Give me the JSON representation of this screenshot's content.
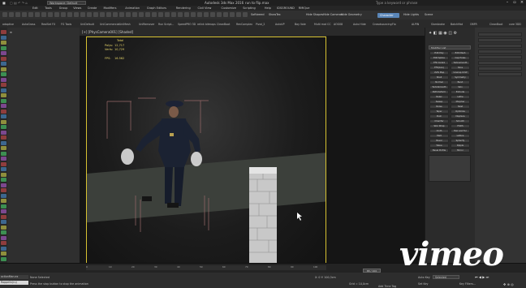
{
  "title_bar": {
    "workspace": "Workspace: Default",
    "app_title": "Autodesk 3ds Max 2016",
    "file_name": "run to flip.max",
    "search_placeholder": "Type a keyword or phrase"
  },
  "menu": [
    "Edit",
    "Tools",
    "Group",
    "Views",
    "Create",
    "Modifiers",
    "Animation",
    "Graph Editors",
    "Rendering",
    "Civil View",
    "Customize",
    "Scripting",
    "Help",
    "IDSGROUND",
    "RMIQue"
  ],
  "toolbar": {
    "labels": [
      "Softbreed",
      "ShowTex",
      "Hide Shapes",
      "Hide Cameras",
      "Hide Geometry",
      "Hide Lights",
      "Scene"
    ],
    "highlighted": "Character"
  },
  "shelf": [
    "adaptive",
    "AutoGrass",
    "RealSet FX",
    "FG Tools",
    "UniDefault",
    "UniCommercial",
    "UniMesh",
    "UniRemover",
    "Run Script...",
    "SpeedPRO 3D",
    "relink bitmaps",
    "CleanBoot",
    "RenComplex",
    "Pivot_2",
    "AutoVP",
    "Bay Vale",
    "Multi mat CC",
    "AOG08",
    "Auto Hide",
    "Crowdsourcing",
    "Flo",
    "ALPIN",
    "Slambrake",
    "BatchMat",
    "OBFR",
    "CleanBoot",
    "core 3DD"
  ],
  "viewport": {
    "label": "[+] [PhysCamera001] [Shaded]",
    "stats": {
      "total_label": "Total",
      "polys_label": "Polys:",
      "polys": "12,717",
      "verts_label": "Verts:",
      "verts": "10,729",
      "fps_label": "FPS:",
      "fps": "16.562"
    }
  },
  "command_panel": {
    "modifier_list": "Modifier List",
    "buttons": [
      "Edit Poly",
      "Edit Mesh",
      "Edit Spline",
      "Cap Holes",
      "FFD 4x4x4",
      "Turbosmooth",
      "FFD(box)",
      "Slice",
      "UVW Map",
      "Unwrap UVW",
      "Shell",
      "Symmetry",
      "Normal",
      "Bend",
      "TurboSmooth",
      "Skin",
      "Path Deform",
      "Extrude",
      "Relax",
      "Lathe",
      "Sweep",
      "Morpher",
      "Noise",
      "Twist",
      "Taper",
      "Optimize",
      "Push",
      "Displace",
      "Chamfer",
      "Smooth",
      "Skin Wrap",
      "HSDS",
      "Cloth",
      "Hair and Fur",
      "Melt",
      "Lattice",
      "Bevel",
      "Spherify",
      "Wave",
      "Ripple",
      "Bevel Profile",
      "Mirror"
    ],
    "bottom_label": "Bend"
  },
  "timeline": {
    "frame_counter": "88 / 100",
    "ticks": [
      "0",
      "10",
      "20",
      "30",
      "40",
      "50",
      "60",
      "70",
      "80",
      "90",
      "100"
    ]
  },
  "status": {
    "maxscript": "actionMan.ex",
    "maxscript2": "Rappelin(ru)",
    "selection": "None Selected",
    "prompt": "Press the stop button to stop the animation",
    "coords": "X: 0  Y: 100,3cm",
    "grid": "Grid = 10,0cm",
    "autokey": "Auto Key",
    "selected": "Selected",
    "setkey": "Set Key",
    "keyfilters": "Key Filters...",
    "add_time_tag": "Add Time Tag"
  },
  "colors": {
    "viewport_border": "#d7c232",
    "highlight": "#5a86b8",
    "stats": "#e8d76a",
    "vimeo": "#ffffff"
  },
  "watermark": "vimeo"
}
